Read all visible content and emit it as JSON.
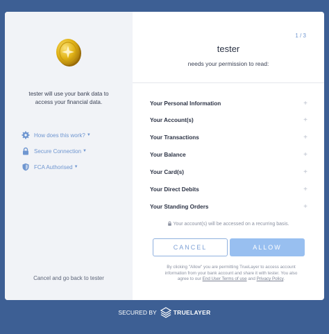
{
  "left_panel": {
    "logo": "gold-coin-icon",
    "description_line1": "tester will use your bank data to",
    "description_line2": "access your financial data.",
    "links": [
      {
        "icon": "gear-icon",
        "label": "How does this work?"
      },
      {
        "icon": "lock-icon",
        "label": "Secure Connection"
      },
      {
        "icon": "shield-icon",
        "label": "FCA Authorised"
      }
    ],
    "cancel_link": "Cancel and go back to tester"
  },
  "right_panel": {
    "step": "1 / 3",
    "app_name": "tester",
    "permission_text": "needs your permission to read:",
    "permissions": [
      "Your Personal Information",
      "Your Account(s)",
      "Your Transactions",
      "Your Balance",
      "Your Card(s)",
      "Your Direct Debits",
      "Your Standing Orders"
    ],
    "recurring_notice": "Your account(s) will be accessed on a recurring basis.",
    "cancel_button": "CANCEL",
    "allow_button": "ALLOW",
    "legal_line1": "By clicking \"Allow\" you are permitting TrueLayer to access account",
    "legal_line2": "information from your bank account and share it with tester. You also",
    "legal_prefix": "agree to our",
    "terms_link": "End User Terms of use",
    "legal_and": "and",
    "privacy_link": "Privacy Policy",
    "legal_end": "."
  },
  "footer": {
    "secured_by": "SECURED BY",
    "brand": "TRUELAYER"
  },
  "colors": {
    "background": "#3d5f94",
    "accent": "#6f96d0",
    "allow_button": "#98bff0",
    "coin": "#e2b417"
  }
}
